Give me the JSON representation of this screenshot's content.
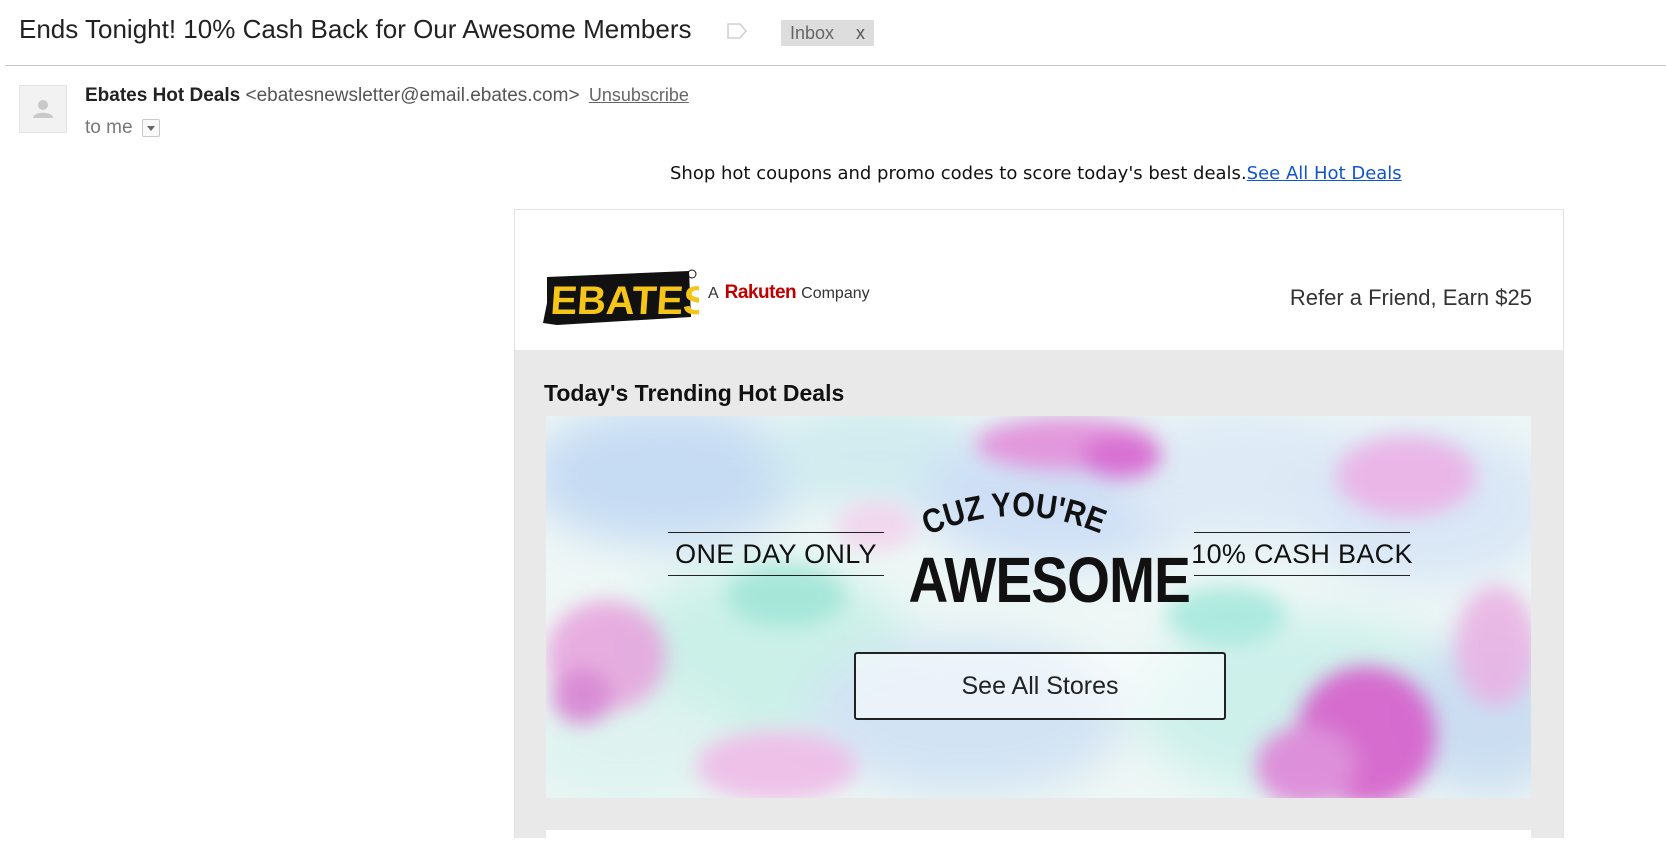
{
  "email": {
    "subject": "Ends Tonight! 10% Cash Back for Our Awesome Members",
    "label": "Inbox",
    "label_remove": "x",
    "sender_name": "Ebates Hot Deals",
    "sender_email": "<ebatesnewsletter@email.ebates.com>",
    "unsubscribe": "Unsubscribe",
    "to": "to me"
  },
  "newsletter": {
    "preheader_text": "Shop hot coupons and promo codes to score today's best deals.",
    "preheader_link": "See All Hot Deals",
    "logo_text": "EBATES",
    "tagline_a": "A",
    "tagline_brand": "Rakuten",
    "tagline_company": "Company",
    "refer_link": "Refer a Friend, Earn $25",
    "section_title": "Today's Trending Hot Deals",
    "banner": {
      "left_text": "ONE DAY ONLY",
      "headline_small": "CUZ YOU'RE",
      "headline_big": "AWESOME",
      "right_text": "10% CASH BACK",
      "cta": "See All Stores"
    }
  },
  "colors": {
    "link": "#1155cc",
    "logo_yellow": "#f5c518",
    "rakuten_red": "#bf0000",
    "card_bg": "#e9e9e9"
  }
}
